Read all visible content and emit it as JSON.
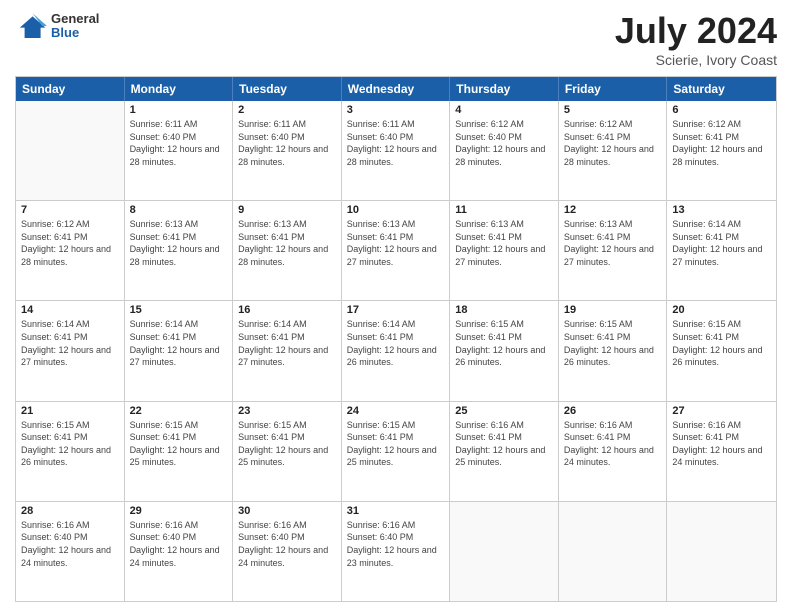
{
  "header": {
    "logo_general": "General",
    "logo_blue": "Blue",
    "month_title": "July 2024",
    "location": "Scierie, Ivory Coast"
  },
  "days_of_week": [
    "Sunday",
    "Monday",
    "Tuesday",
    "Wednesday",
    "Thursday",
    "Friday",
    "Saturday"
  ],
  "weeks": [
    [
      {
        "day": "",
        "empty": true
      },
      {
        "day": "1",
        "sunrise": "6:11 AM",
        "sunset": "6:40 PM",
        "daylight": "12 hours and 28 minutes."
      },
      {
        "day": "2",
        "sunrise": "6:11 AM",
        "sunset": "6:40 PM",
        "daylight": "12 hours and 28 minutes."
      },
      {
        "day": "3",
        "sunrise": "6:11 AM",
        "sunset": "6:40 PM",
        "daylight": "12 hours and 28 minutes."
      },
      {
        "day": "4",
        "sunrise": "6:12 AM",
        "sunset": "6:40 PM",
        "daylight": "12 hours and 28 minutes."
      },
      {
        "day": "5",
        "sunrise": "6:12 AM",
        "sunset": "6:41 PM",
        "daylight": "12 hours and 28 minutes."
      },
      {
        "day": "6",
        "sunrise": "6:12 AM",
        "sunset": "6:41 PM",
        "daylight": "12 hours and 28 minutes."
      }
    ],
    [
      {
        "day": "7",
        "sunrise": "6:12 AM",
        "sunset": "6:41 PM",
        "daylight": "12 hours and 28 minutes."
      },
      {
        "day": "8",
        "sunrise": "6:13 AM",
        "sunset": "6:41 PM",
        "daylight": "12 hours and 28 minutes."
      },
      {
        "day": "9",
        "sunrise": "6:13 AM",
        "sunset": "6:41 PM",
        "daylight": "12 hours and 28 minutes."
      },
      {
        "day": "10",
        "sunrise": "6:13 AM",
        "sunset": "6:41 PM",
        "daylight": "12 hours and 27 minutes."
      },
      {
        "day": "11",
        "sunrise": "6:13 AM",
        "sunset": "6:41 PM",
        "daylight": "12 hours and 27 minutes."
      },
      {
        "day": "12",
        "sunrise": "6:13 AM",
        "sunset": "6:41 PM",
        "daylight": "12 hours and 27 minutes."
      },
      {
        "day": "13",
        "sunrise": "6:14 AM",
        "sunset": "6:41 PM",
        "daylight": "12 hours and 27 minutes."
      }
    ],
    [
      {
        "day": "14",
        "sunrise": "6:14 AM",
        "sunset": "6:41 PM",
        "daylight": "12 hours and 27 minutes."
      },
      {
        "day": "15",
        "sunrise": "6:14 AM",
        "sunset": "6:41 PM",
        "daylight": "12 hours and 27 minutes."
      },
      {
        "day": "16",
        "sunrise": "6:14 AM",
        "sunset": "6:41 PM",
        "daylight": "12 hours and 27 minutes."
      },
      {
        "day": "17",
        "sunrise": "6:14 AM",
        "sunset": "6:41 PM",
        "daylight": "12 hours and 26 minutes."
      },
      {
        "day": "18",
        "sunrise": "6:15 AM",
        "sunset": "6:41 PM",
        "daylight": "12 hours and 26 minutes."
      },
      {
        "day": "19",
        "sunrise": "6:15 AM",
        "sunset": "6:41 PM",
        "daylight": "12 hours and 26 minutes."
      },
      {
        "day": "20",
        "sunrise": "6:15 AM",
        "sunset": "6:41 PM",
        "daylight": "12 hours and 26 minutes."
      }
    ],
    [
      {
        "day": "21",
        "sunrise": "6:15 AM",
        "sunset": "6:41 PM",
        "daylight": "12 hours and 26 minutes."
      },
      {
        "day": "22",
        "sunrise": "6:15 AM",
        "sunset": "6:41 PM",
        "daylight": "12 hours and 25 minutes."
      },
      {
        "day": "23",
        "sunrise": "6:15 AM",
        "sunset": "6:41 PM",
        "daylight": "12 hours and 25 minutes."
      },
      {
        "day": "24",
        "sunrise": "6:15 AM",
        "sunset": "6:41 PM",
        "daylight": "12 hours and 25 minutes."
      },
      {
        "day": "25",
        "sunrise": "6:16 AM",
        "sunset": "6:41 PM",
        "daylight": "12 hours and 25 minutes."
      },
      {
        "day": "26",
        "sunrise": "6:16 AM",
        "sunset": "6:41 PM",
        "daylight": "12 hours and 24 minutes."
      },
      {
        "day": "27",
        "sunrise": "6:16 AM",
        "sunset": "6:41 PM",
        "daylight": "12 hours and 24 minutes."
      }
    ],
    [
      {
        "day": "28",
        "sunrise": "6:16 AM",
        "sunset": "6:40 PM",
        "daylight": "12 hours and 24 minutes."
      },
      {
        "day": "29",
        "sunrise": "6:16 AM",
        "sunset": "6:40 PM",
        "daylight": "12 hours and 24 minutes."
      },
      {
        "day": "30",
        "sunrise": "6:16 AM",
        "sunset": "6:40 PM",
        "daylight": "12 hours and 24 minutes."
      },
      {
        "day": "31",
        "sunrise": "6:16 AM",
        "sunset": "6:40 PM",
        "daylight": "12 hours and 23 minutes."
      },
      {
        "day": "",
        "empty": true
      },
      {
        "day": "",
        "empty": true
      },
      {
        "day": "",
        "empty": true
      }
    ]
  ]
}
